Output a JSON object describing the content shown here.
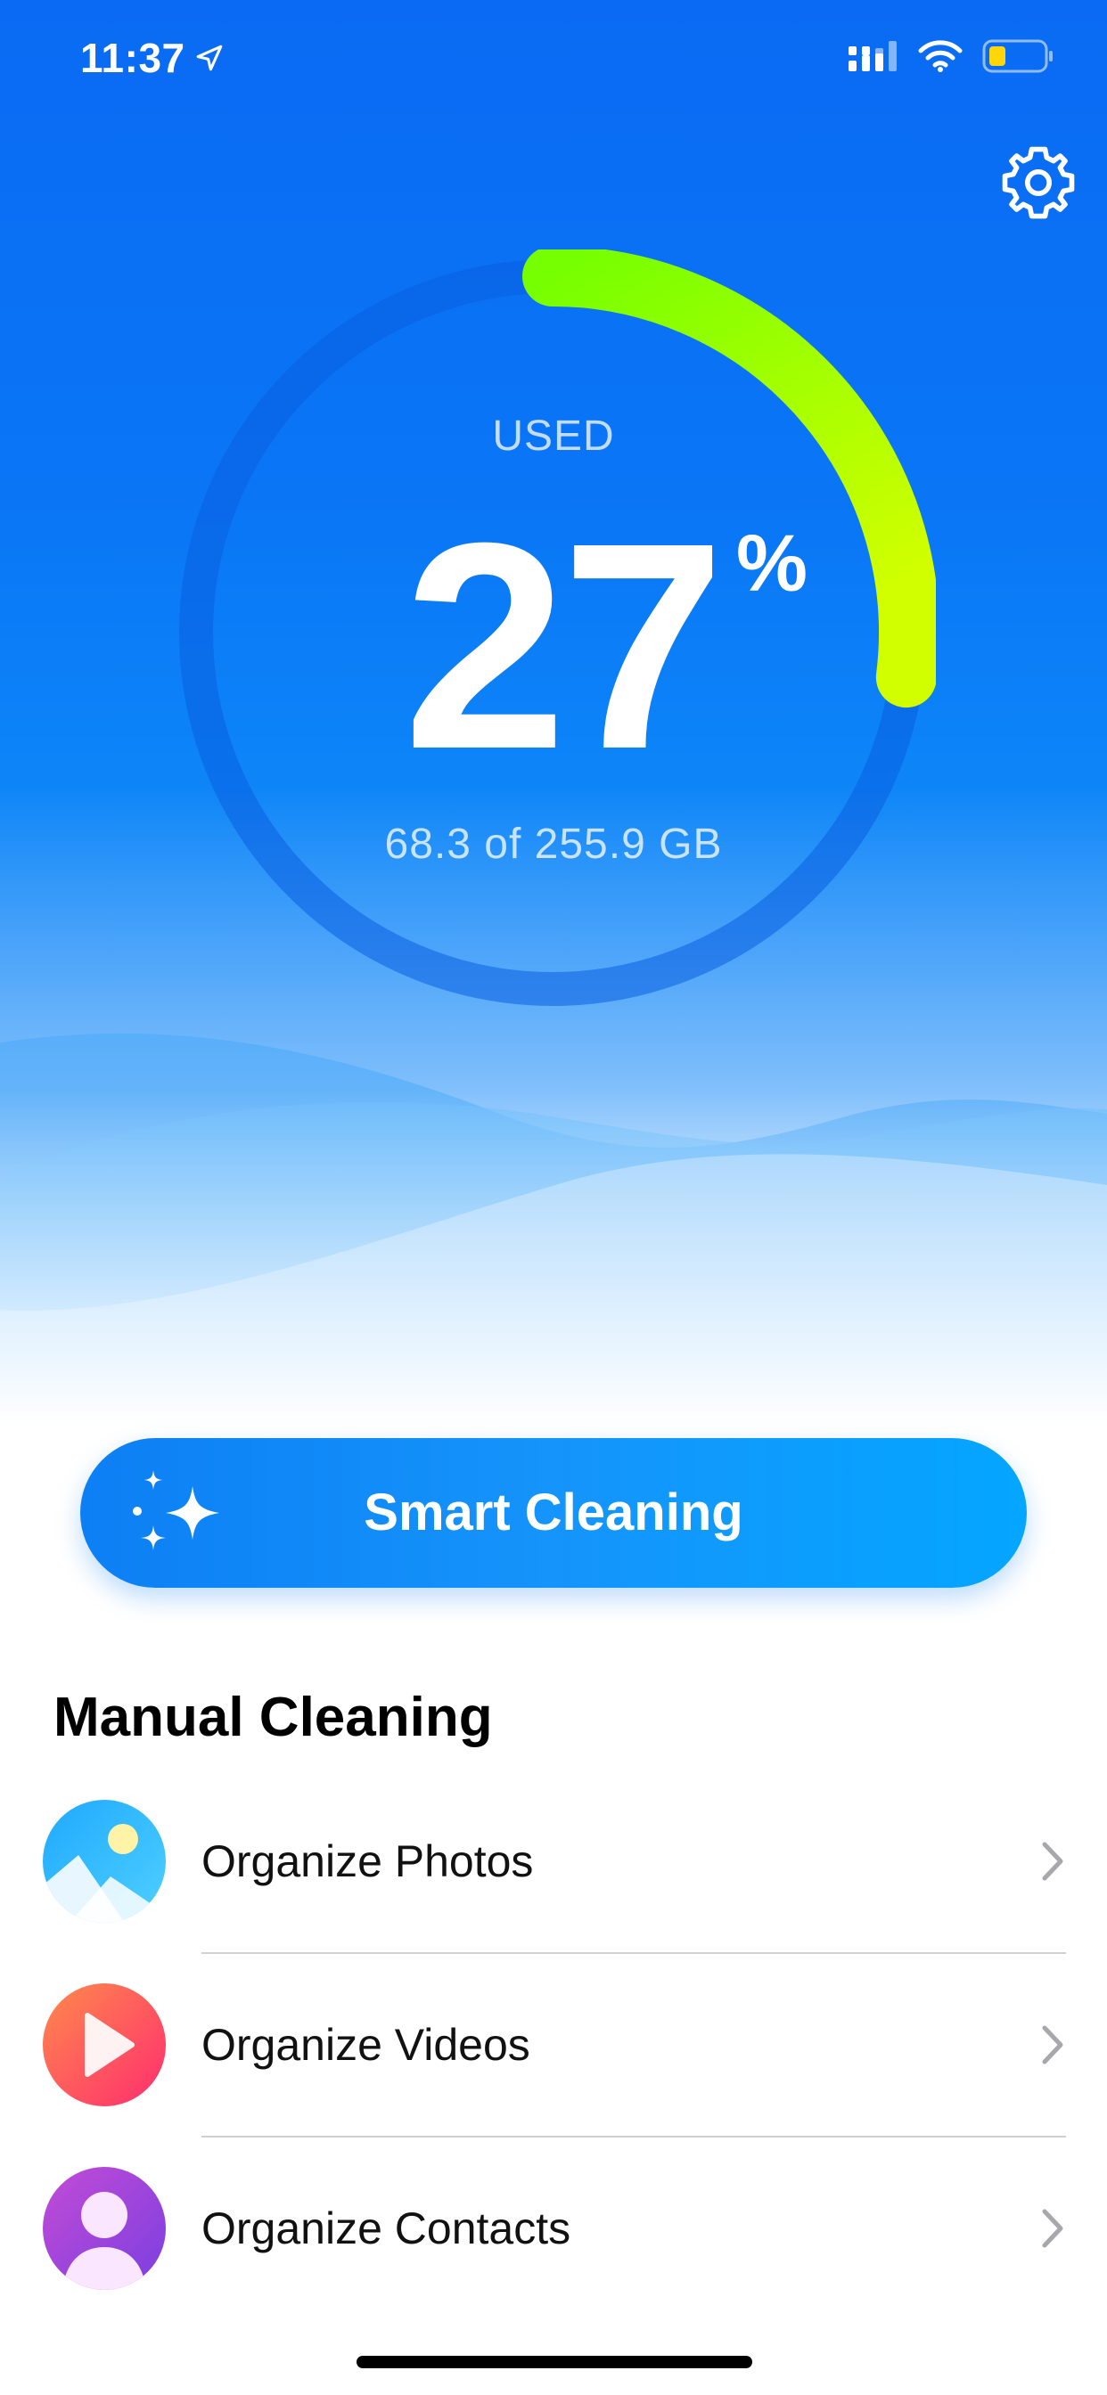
{
  "status_bar": {
    "time": "11:37"
  },
  "gauge": {
    "label": "USED",
    "percent": "27",
    "percent_sign": "%",
    "storage_text": "68.3 of 255.9 GB",
    "used_fraction": 0.27
  },
  "smart_cleaning": {
    "label": "Smart Cleaning"
  },
  "manual_cleaning": {
    "title": "Manual Cleaning",
    "items": [
      {
        "label": "Organize Photos",
        "icon": "photos-icon"
      },
      {
        "label": "Organize Videos",
        "icon": "videos-icon"
      },
      {
        "label": "Organize Contacts",
        "icon": "contacts-icon"
      }
    ]
  },
  "colors": {
    "hero_blue": "#0a6af3",
    "accent_green": "#7cfc00",
    "accent_yellow": "#d4ff00",
    "button_blue": "#1594fb"
  }
}
